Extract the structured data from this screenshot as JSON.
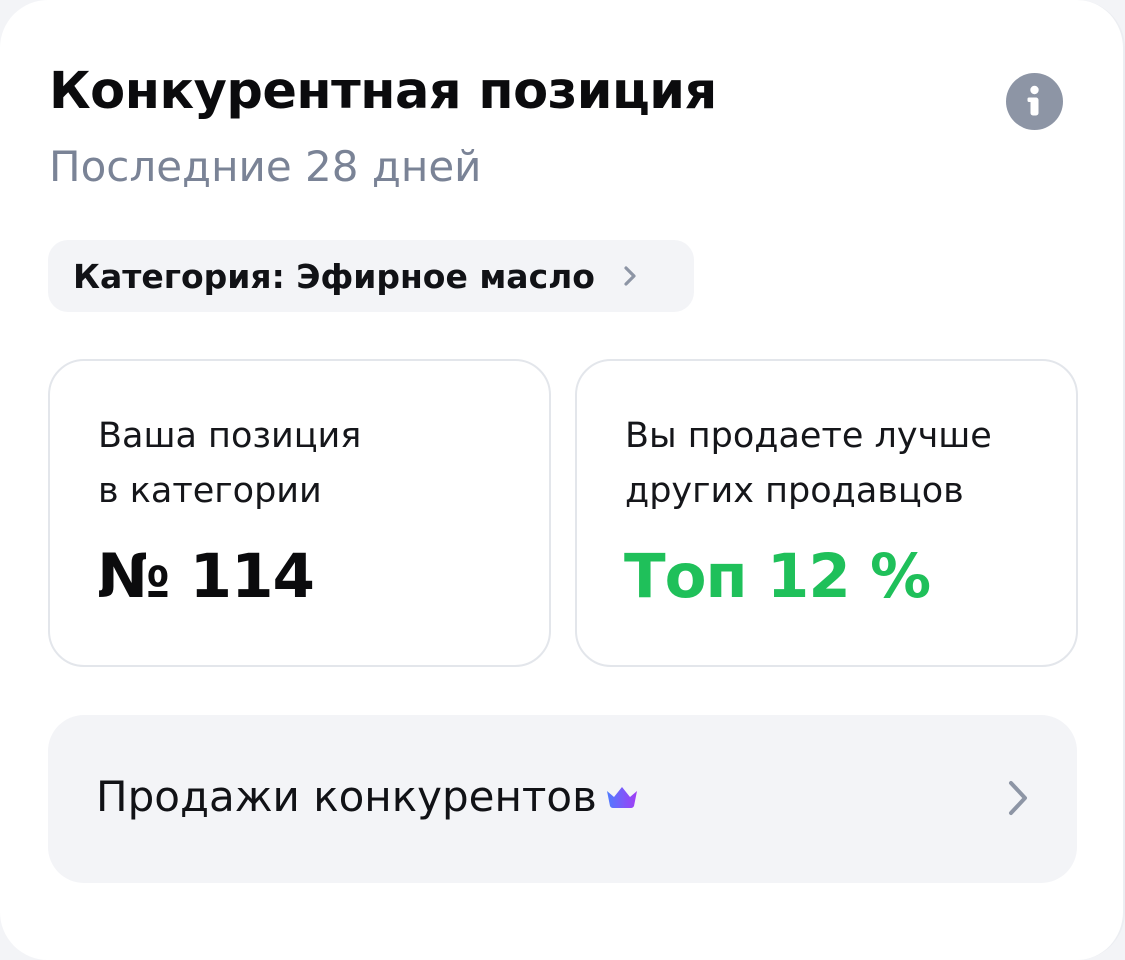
{
  "header": {
    "title": "Конкурентная позиция",
    "subtitle": "Последние 28 дней",
    "info_icon": "info-icon"
  },
  "category_chip": {
    "label": "Категория: Эфирное масло",
    "icon": "chevron-right-icon"
  },
  "stats": [
    {
      "label": "Ваша позиция\nв категории",
      "value": "№ 114",
      "color": "#0b0b0d"
    },
    {
      "label": "Вы продаете лучше\nдругих продавцов",
      "value": "Топ 12 %",
      "color": "#1fc05a"
    }
  ],
  "competitors_row": {
    "label": "Продажи конкурентов",
    "badge_icon": "crown-icon",
    "icon": "chevron-right-icon"
  },
  "colors": {
    "accent_green": "#1fc05a",
    "muted_text": "#7a8396",
    "surface": "#f3f4f7",
    "crown_gradient": [
      "#4f7cff",
      "#a23cf5"
    ]
  }
}
